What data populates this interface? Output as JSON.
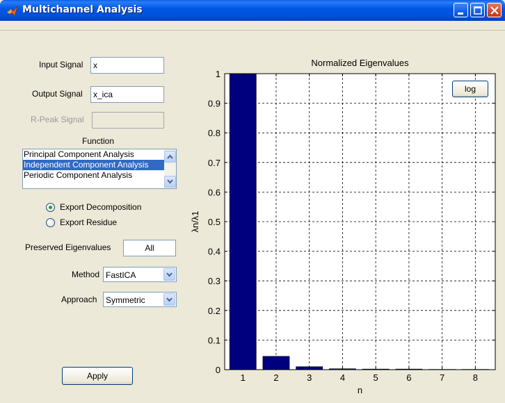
{
  "window": {
    "title": "Multichannel Analysis"
  },
  "form": {
    "input_signal_label": "Input Signal",
    "input_signal_value": "x",
    "output_signal_label": "Output Signal",
    "output_signal_value": "x_ica",
    "rpeak_label": "R-Peak Signal",
    "rpeak_value": "",
    "function_label": "Function",
    "function_items": [
      "Principal Component Analysis",
      "Independent Component Analysis",
      "Periodic Component Analysis"
    ],
    "function_selected_index": 1,
    "export_decomposition_label": "Export Decomposition",
    "export_residue_label": "Export Residue",
    "export_selected": "decomposition",
    "preserved_label": "Preserved Eigenvalues",
    "preserved_value": "All",
    "method_label": "Method",
    "method_value": "FastICA",
    "approach_label": "Approach",
    "approach_value": "Symmetric",
    "apply_label": "Apply"
  },
  "plot": {
    "log_label": "log"
  },
  "chart_data": {
    "type": "bar",
    "title": "Normalized Eigenvalues",
    "xlabel": "n",
    "ylabel": "λn/λ1",
    "categories": [
      "1",
      "2",
      "3",
      "4",
      "5",
      "6",
      "7",
      "8"
    ],
    "values": [
      1.0,
      0.045,
      0.01,
      0.003,
      0.002,
      0.002,
      0.001,
      0.001
    ],
    "ylim": [
      0,
      1
    ],
    "yticks": [
      "0",
      "0.1",
      "0.2",
      "0.3",
      "0.4",
      "0.5",
      "0.6",
      "0.7",
      "0.8",
      "0.9",
      "1"
    ],
    "grid": true,
    "bar_color": "#00007f"
  }
}
